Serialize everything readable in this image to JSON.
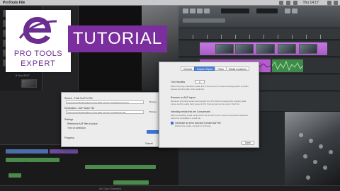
{
  "menubar": {
    "app_name": "ProTools File",
    "clock": "Thu 14:17"
  },
  "branding": {
    "logo_line1": "PRO TOOLS",
    "logo_line2": "EXPERT",
    "band_text": "TUTORIAL",
    "band_color": "#7b2e9d",
    "logo_color": "#6b2d8f"
  },
  "import_dialog": {
    "source_label": "Source - Final Cut Pro File",
    "source_path": "/Users/user/Desktop/Export File Mike On Pro Tools/Export.fcpxml",
    "destination_label": "Destination - AAF Audio File",
    "destination_path": "/Users/user/Desktop/Export File Mike On Pro Tools/Export.aaf",
    "browse_label": "Browse",
    "settings_label": "Settings",
    "reference_label": "Reference AAF files in place",
    "trim_label": "Trim on selection",
    "progress_label": "Progress",
    "cancel_label": "Cancel"
  },
  "preferences_dialog": {
    "tabs": [
      "General",
      "Import / Export",
      "Roles",
      "Media Locations"
    ],
    "active_tab": "Import / Export",
    "handles_label": "Trim Handles",
    "handles_value": "0",
    "handles_desc1": "When trimming embedded media, this is the amount of media remaining before and after",
    "handles_desc2": "the last and first edits of the media file.",
    "rename_label": "Rename on AAF import",
    "rename_desc1": "Renames and track names are imported from Pro Tools for keeping the original media",
    "rename_desc2": "names and the audio track names in Pro Tools as well as the ones in Final Cut.",
    "handling_label": "Handling media that are Compressed",
    "handling_desc1": "When embedding media, audio which can be 32 bit or be mixed compressed media that",
    "handling_desc2": "cannot be embedded in a AAF file.",
    "option_label": "Generate an error and don't create AAF file",
    "option_desc": "(Embed the media, uncheck to trimming)",
    "done_label": "Done"
  },
  "browser": {
    "library_label": "5 Jun 2017"
  },
  "statusbar": {
    "text": "All Clips Selected"
  }
}
